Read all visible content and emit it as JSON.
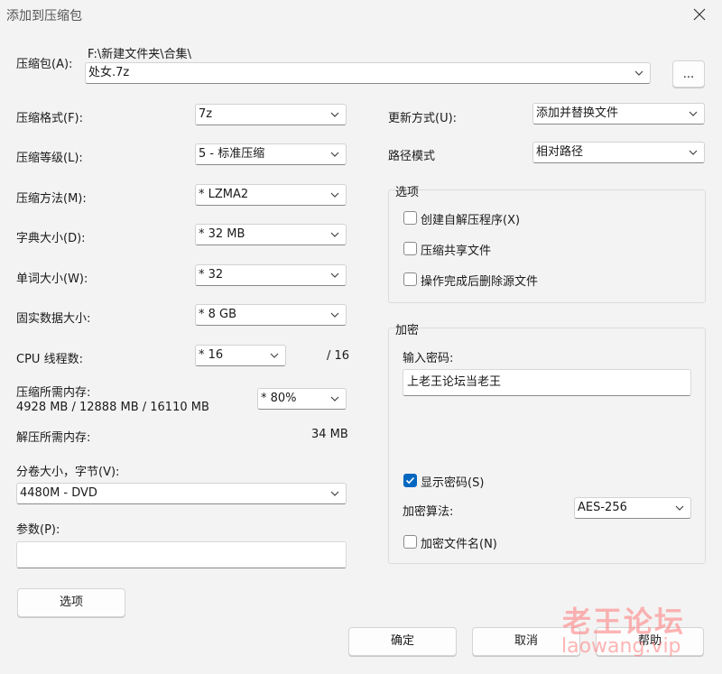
{
  "window": {
    "title": "添加到压缩包"
  },
  "archive": {
    "label": "压缩包(A):",
    "path": "F:\\新建文件夹\\合集\\",
    "filename": "处女.7z",
    "browse_label": "..."
  },
  "left": {
    "format_label": "压缩格式(F):",
    "format_value": "7z",
    "level_label": "压缩等级(L):",
    "level_value": "5 - 标准压缩",
    "method_label": "压缩方法(M):",
    "method_value": "*  LZMA2",
    "dict_label": "字典大小(D):",
    "dict_value": "*  32 MB",
    "word_label": "单词大小(W):",
    "word_value": "*  32",
    "solid_label": "固实数据大小:",
    "solid_value": "*  8 GB",
    "threads_label": "CPU 线程数:",
    "threads_value": "*  16",
    "threads_total": "/ 16",
    "mem_label": "压缩所需内存:",
    "mem_detail": "4928 MB / 12888 MB / 16110 MB",
    "mem_value": "*  80%",
    "decomp_label": "解压所需内存:",
    "decomp_value": "34 MB",
    "split_label": "分卷大小，字节(V):",
    "split_value": "4480M - DVD",
    "params_label": "参数(P):",
    "params_value": "",
    "options_button": "选项"
  },
  "right": {
    "update_label": "更新方式(U):",
    "update_value": "添加并替换文件",
    "path_label": "路径模式",
    "path_value": "相对路径",
    "options_group": "选项",
    "opt_sfx": "创建自解压程序(X)",
    "opt_shared": "压缩共享文件",
    "opt_delete": "操作完成后删除源文件",
    "encrypt_group": "加密",
    "password_label": "输入密码:",
    "password_value": "上老王论坛当老王",
    "show_password": "显示密码(S)",
    "enc_method_label": "加密算法:",
    "enc_method_value": "AES-256",
    "enc_filenames": "加密文件名(N)"
  },
  "buttons": {
    "ok": "确定",
    "cancel": "取消",
    "help": "帮助"
  },
  "watermark": {
    "text": "老王论坛",
    "url": "laowang.vip"
  }
}
